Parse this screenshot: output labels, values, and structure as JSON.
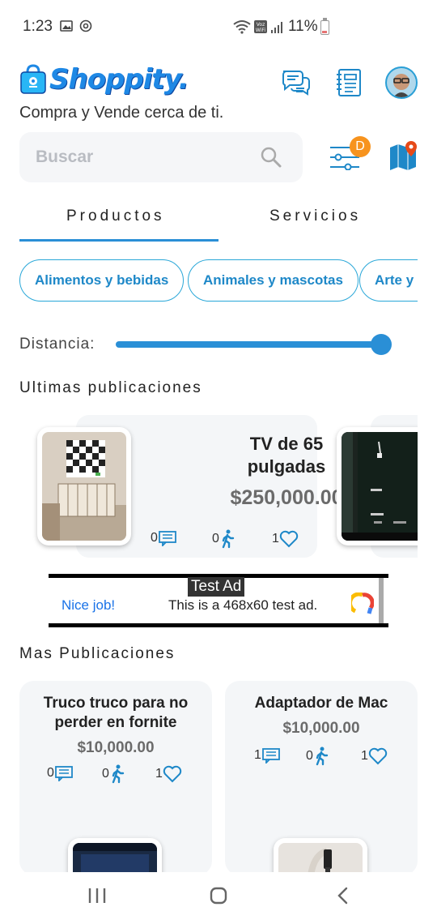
{
  "status_bar": {
    "time": "1:23",
    "battery": "11%"
  },
  "header": {
    "app_name": "Shoppity.",
    "tagline": "Compra y Vende cerca de ti."
  },
  "search": {
    "placeholder": "Buscar"
  },
  "filter_badge": "D",
  "tabs": [
    {
      "label": "Productos",
      "active": true
    },
    {
      "label": "Servicios",
      "active": false
    }
  ],
  "categories": [
    "Alimentos y bebidas",
    "Animales y mascotas",
    "Arte y a"
  ],
  "distance": {
    "label": "Distancia:",
    "value_fraction": 1.0
  },
  "latest": {
    "title": "Ultimas publicaciones",
    "items": [
      {
        "title": "TV de 65 pulgadas",
        "price": "$250,000.00",
        "comments": "0",
        "visits": "0",
        "likes": "1"
      }
    ]
  },
  "ad": {
    "label": "Test Ad",
    "headline": "Nice job!",
    "body": "This is a 468x60 test ad."
  },
  "more": {
    "title": "Mas Publicaciones",
    "items": [
      {
        "title": "Truco truco para no perder en fornite",
        "price": "$10,000.00",
        "comments": "0",
        "visits": "0",
        "likes": "1"
      },
      {
        "title": "Adaptador de Mac",
        "price": "$10,000.00",
        "comments": "1",
        "visits": "0",
        "likes": "1"
      }
    ]
  },
  "colors": {
    "accent": "#2a8fd6",
    "chip_border": "#29a7d8",
    "badge": "#f7931e",
    "price_gray": "#6b6b6b",
    "card_bg": "#f4f6f8"
  },
  "icons": {
    "chat": "chat-bubbles-icon",
    "notebook": "notebook-icon",
    "search": "search-icon",
    "filter": "filter-sliders-icon",
    "map": "map-pin-icon",
    "comment": "comment-icon",
    "visit": "walking-person-icon",
    "like": "heart-icon"
  }
}
